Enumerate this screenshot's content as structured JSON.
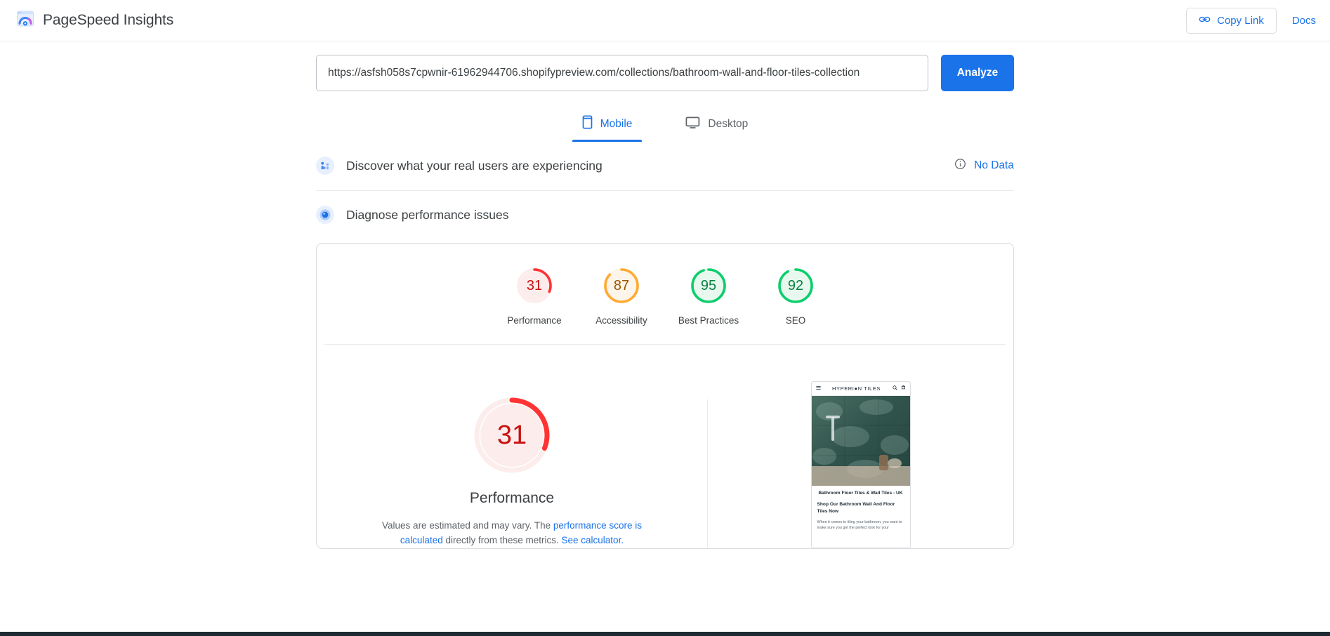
{
  "header": {
    "brand": "PageSpeed Insights",
    "logo_icon": "pagespeed-speedometer-icon",
    "copy_link_label": "Copy Link",
    "copy_link_icon": "link-chain-icon",
    "docs_label": "Docs",
    "accent_blue": "#1a73e8"
  },
  "search": {
    "url_value": "https://asfsh058s7cpwnir-61962944706.shopifypreview.com/collections/bathroom-wall-and-floor-tiles-collection",
    "url_placeholder": "Enter a web page URL",
    "analyze_label": "Analyze"
  },
  "tabs": [
    {
      "label": "Mobile",
      "icon": "mobile-phone-icon",
      "active": true
    },
    {
      "label": "Desktop",
      "icon": "desktop-monitor-icon",
      "active": false
    }
  ],
  "field_data": {
    "title": "Discover what your real users are experiencing",
    "icon": "real-user-data-icon",
    "status": "No Data",
    "info_icon": "info-circle-icon"
  },
  "lab_data": {
    "title": "Diagnose performance issues",
    "icon": "lighthouse-icon"
  },
  "scores": [
    {
      "label": "Performance",
      "value": 31,
      "color": "#f33",
      "track": "#fdecec",
      "text_color": "#c8110f"
    },
    {
      "label": "Accessibility",
      "value": 87,
      "color": "#fa3",
      "track": "#fdf5e9",
      "text_color": "#9c5400"
    },
    {
      "label": "Best Practices",
      "value": 95,
      "color": "#0cce6b",
      "track": "#e8f8ef",
      "text_color": "#078141"
    },
    {
      "label": "SEO",
      "value": 92,
      "color": "#0cce6b",
      "track": "#e8f8ef",
      "text_color": "#078141"
    }
  ],
  "performance_panel": {
    "value": 31,
    "label": "Performance",
    "desc_part1": "Values are estimated and may vary. The ",
    "desc_link1": "performance score is calculated",
    "desc_part2": " directly from these metrics. ",
    "desc_link2": "See calculator.",
    "color": "#f33",
    "track": "#fdecec",
    "text_color": "#c8110f"
  },
  "screenshot": {
    "store_name": "HYPERI●N TILES",
    "menu_icon": "hamburger-menu-icon",
    "search_icon": "search-icon",
    "cart_icon": "shopping-cart-icon",
    "heading": "Bathroom Floor Tiles & Wall Tiles - UK",
    "subheading": "Shop Our Bathroom Wall And Floor Tiles Now",
    "paragraph": "When it comes to tiling your bathroom, you want to make sure you get the perfect look for your"
  }
}
